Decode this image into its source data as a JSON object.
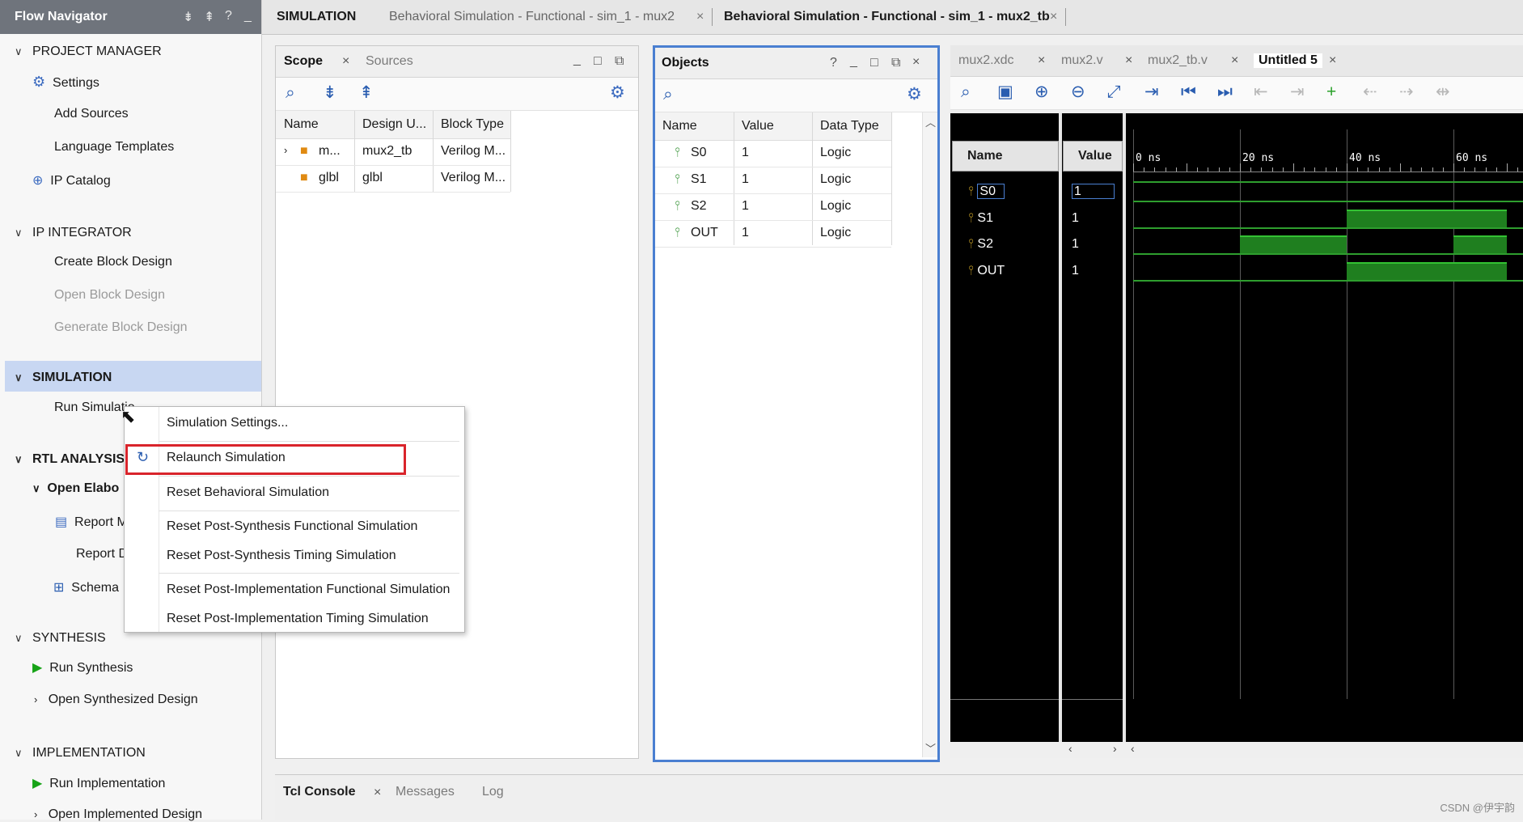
{
  "flow_navigator": {
    "title": "Flow Navigator",
    "icons": [
      "collapse-all-icon",
      "expand-all-icon",
      "help-icon",
      "minimize-icon"
    ],
    "sections": [
      {
        "label": "PROJECT MANAGER",
        "items": [
          {
            "label": "Settings",
            "icon": "gear-icon"
          },
          {
            "label": "Add Sources"
          },
          {
            "label": "Language Templates"
          },
          {
            "label": "IP Catalog",
            "icon": "plug-icon"
          }
        ]
      },
      {
        "label": "IP INTEGRATOR",
        "items": [
          {
            "label": "Create Block Design"
          },
          {
            "label": "Open Block Design",
            "disabled": true
          },
          {
            "label": "Generate Block Design",
            "disabled": true
          }
        ]
      },
      {
        "label": "SIMULATION",
        "items": [
          {
            "label": "Run Simulation"
          }
        ]
      },
      {
        "label": "RTL ANALYSIS",
        "items": [
          {
            "label": "Open Elabo"
          },
          {
            "label": "Report M"
          },
          {
            "label": "Report D"
          },
          {
            "label": "Schema"
          }
        ]
      },
      {
        "label": "SYNTHESIS",
        "items": [
          {
            "label": "Run Synthesis",
            "icon": "play-icon"
          },
          {
            "label": "Open Synthesized Design"
          }
        ]
      },
      {
        "label": "IMPLEMENTATION",
        "items": [
          {
            "label": "Run Implementation",
            "icon": "play-icon"
          },
          {
            "label": "Open Implemented Design"
          }
        ]
      }
    ]
  },
  "top_tabs": {
    "context": "SIMULATION",
    "tab1": "Behavioral Simulation - Functional - sim_1 - mux2",
    "tab2": "Behavioral Simulation - Functional - sim_1 - mux2_tb"
  },
  "scope_panel": {
    "tabs": [
      "Scope",
      "Sources"
    ],
    "columns": [
      "Name",
      "Design U...",
      "Block Type"
    ],
    "rows": [
      {
        "name": "m...",
        "design_unit": "mux2_tb",
        "block_type": "Verilog M..."
      },
      {
        "name": "glbl",
        "design_unit": "glbl",
        "block_type": "Verilog M..."
      }
    ]
  },
  "objects_panel": {
    "title": "Objects",
    "columns": [
      "Name",
      "Value",
      "Data Type"
    ],
    "rows": [
      {
        "name": "S0",
        "value": "1",
        "type": "Logic"
      },
      {
        "name": "S1",
        "value": "1",
        "type": "Logic"
      },
      {
        "name": "S2",
        "value": "1",
        "type": "Logic"
      },
      {
        "name": "OUT",
        "value": "1",
        "type": "Logic"
      }
    ]
  },
  "wave_panel": {
    "tabs": [
      "mux2.xdc",
      "mux2.v",
      "mux2_tb.v",
      "Untitled 5"
    ],
    "name_header": "Name",
    "value_header": "Value",
    "ticks": [
      "0 ns",
      "20 ns",
      "40 ns",
      "60 ns"
    ],
    "signals": [
      {
        "name": "S0",
        "value": "1",
        "high_segments": []
      },
      {
        "name": "S1",
        "value": "1",
        "high_segments": [
          [
            40,
            70
          ]
        ]
      },
      {
        "name": "S2",
        "value": "1",
        "high_segments": [
          [
            20,
            40
          ],
          [
            60,
            70
          ]
        ]
      },
      {
        "name": "OUT",
        "value": "1",
        "high_segments": [
          [
            40,
            70
          ]
        ]
      }
    ]
  },
  "context_menu": {
    "items": [
      "Simulation Settings...",
      "Relaunch Simulation",
      "Reset Behavioral Simulation",
      "Reset Post-Synthesis Functional Simulation",
      "Reset Post-Synthesis Timing Simulation",
      "Reset Post-Implementation Functional Simulation",
      "Reset Post-Implementation Timing Simulation"
    ]
  },
  "console": {
    "tabs": [
      "Tcl Console",
      "Messages",
      "Log"
    ]
  },
  "watermark": "CSDN @伊宇韵"
}
